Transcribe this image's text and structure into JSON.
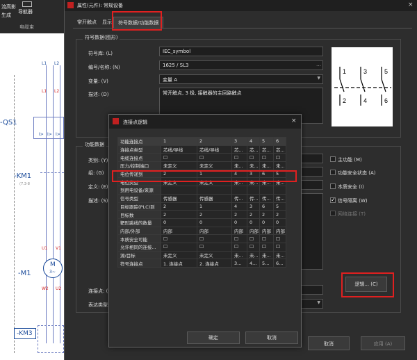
{
  "left_panel": {
    "toolbar_fragments": [
      "流高影",
      "生成",
      "导航器",
      "电缆束"
    ],
    "schematic_labels": {
      "qs1": "-QS1",
      "km1": "-KM1",
      "km1_sub": "(7.3-8",
      "m1": "-M1",
      "km3": "-KM3",
      "top_l": [
        "L1",
        "L2",
        "L1",
        "L2"
      ],
      "motor_m": "M",
      "motor_3": "3~",
      "terminals": [
        "U1",
        "V1",
        "W2",
        "U2"
      ],
      "breaker_vals": [
        "I>",
        "I>",
        "I>"
      ]
    }
  },
  "dialog": {
    "title": "属性(元件): 常规设备",
    "tabs": [
      "常开触点",
      "显示",
      "符号数据/功能数据"
    ],
    "symbol_group_title": "符号数据(图形)",
    "symbol_library_label": "符号库: (L)",
    "symbol_library_value": "IEC_symbol",
    "number_name_label": "编号/名称: (N)",
    "number_name_value": "1625 / SL3",
    "variant_label": "变量: (V)",
    "variant_value": "变量 A",
    "description_label": "描述: (D)",
    "description_value": "常开触点, 3 极, 接触器的主回路触点",
    "symbol_preview": {
      "top_pins": [
        "1",
        "3",
        "5"
      ],
      "bottom_pins": [
        "2",
        "4",
        "6"
      ]
    },
    "function_group_title": "功能数据",
    "function_labels": [
      "类别: (Y)",
      "组: (G)",
      "定义: (E)",
      "描述: (S)"
    ],
    "connection_label": "连接点: (O)",
    "representation_label": "表达类型:",
    "checkboxes": [
      {
        "label": "主功能 (M)",
        "checked": false
      },
      {
        "label": "功能安全状态 (A)",
        "checked": false
      },
      {
        "label": "本质安全 (I)",
        "checked": false
      },
      {
        "label": "信号隔离 (W)",
        "checked": true
      },
      {
        "label": "网络连接 (T)",
        "checked": false
      }
    ],
    "logic_button": "逻辑... (C)",
    "cancel_button": "取消",
    "apply_button": "应用 (A)"
  },
  "logic_dialog": {
    "title": "连接点逻辑",
    "columns": [
      "1",
      "2",
      "3",
      "4",
      "5",
      "6"
    ],
    "rows": [
      {
        "label": "功能连接点",
        "values": [
          "1",
          "2",
          "3",
          "4",
          "5",
          "6"
        ]
      },
      {
        "label": "连接点类型",
        "values": [
          "芯线/导线",
          "芯线/导线",
          "芯...",
          "芯...",
          "芯...",
          "芯..."
        ]
      },
      {
        "label": "电缆连接点",
        "values": [
          "☐",
          "☐",
          "☐",
          "☐",
          "☐",
          "☐"
        ]
      },
      {
        "label": "压力/控制端口",
        "values": [
          "未定义",
          "未定义",
          "未...",
          "未...",
          "未...",
          "未..."
        ]
      },
      {
        "label": "电位传递到",
        "values": [
          "2",
          "1",
          "4",
          "3",
          "6",
          "5"
        ]
      },
      {
        "label": "电位类型",
        "values": [
          "未定义",
          "未定义",
          "未...",
          "未...",
          "未...",
          "未..."
        ]
      },
      {
        "label": "到用电设备/来源",
        "values": [
          "",
          "",
          "",
          "",
          "",
          ""
        ]
      },
      {
        "label": "信号类型",
        "values": [
          "传感器",
          "传感器",
          "传...",
          "传...",
          "传...",
          "传..."
        ]
      },
      {
        "label": "目标跟踪(PLC)到",
        "values": [
          "2",
          "1",
          "4",
          "3",
          "6",
          "5"
        ]
      },
      {
        "label": "目标数",
        "values": [
          "2",
          "2",
          "2",
          "2",
          "2",
          "2"
        ]
      },
      {
        "label": "靶形跳线的数量",
        "values": [
          "0",
          "0",
          "0",
          "0",
          "0",
          "0"
        ]
      },
      {
        "label": "内部/外部",
        "values": [
          "内部",
          "内部",
          "内部",
          "内部",
          "内部",
          "内部"
        ]
      },
      {
        "label": "本质安全可能",
        "values": [
          "☐",
          "☐",
          "☐",
          "☐",
          "☐",
          "☐"
        ]
      },
      {
        "label": "允许相同的连接...",
        "values": [
          "☐",
          "☐",
          "☐",
          "☐",
          "☐",
          "☐"
        ]
      },
      {
        "label": "源/目标",
        "values": [
          "未定义",
          "未定义",
          "未...",
          "未...",
          "未...",
          "未..."
        ]
      },
      {
        "label": "符号连接点",
        "values": [
          "1. 连接点",
          "2. 连接点",
          "3...",
          "4...",
          "5...",
          "6..."
        ]
      }
    ],
    "ok_button": "确定",
    "cancel_button": "取消"
  },
  "colors": {
    "dialog_bg": "#2d2d2d",
    "highlight_red": "#e02020"
  }
}
